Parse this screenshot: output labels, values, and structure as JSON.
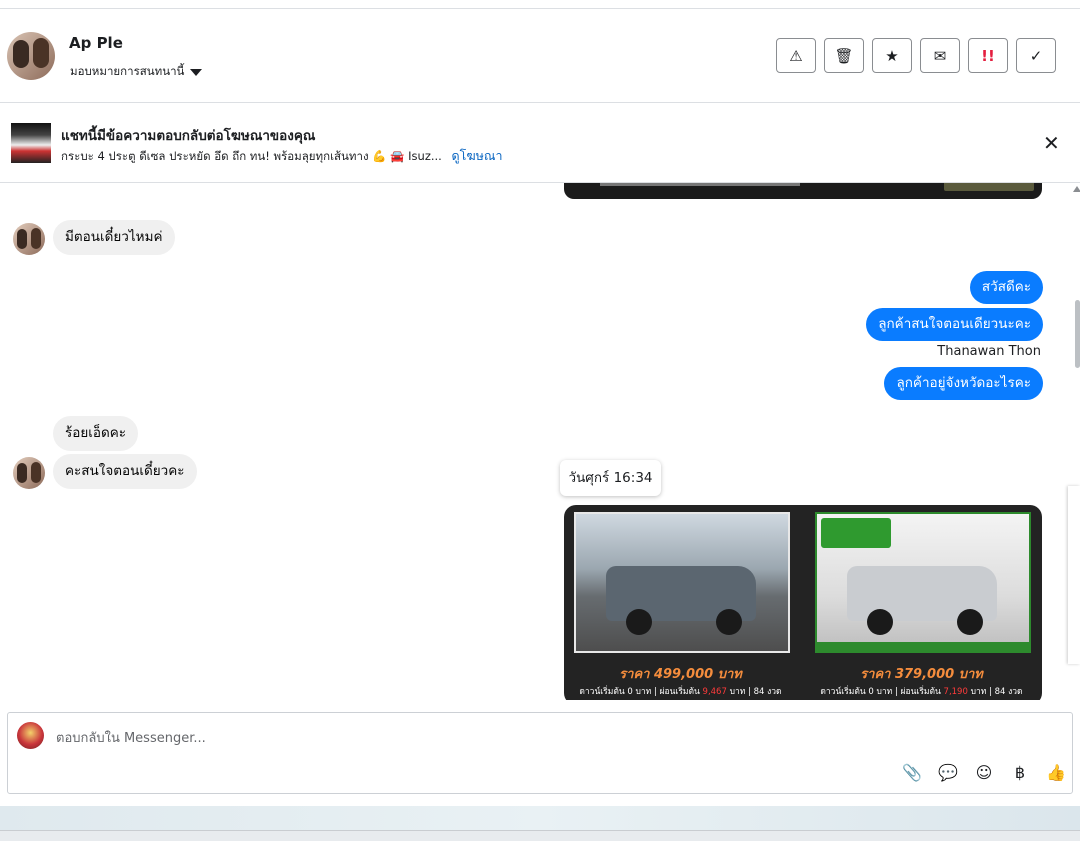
{
  "header": {
    "contact_name": "Ap Ple",
    "assign_label": "มอบหมายการสนทนานี้",
    "actions": [
      {
        "name": "report-spam-icon",
        "glyph": "⚠"
      },
      {
        "name": "trash-icon",
        "glyph": "🗑"
      },
      {
        "name": "star-icon",
        "glyph": "★"
      },
      {
        "name": "mark-unread-icon",
        "glyph": "✉"
      },
      {
        "name": "follow-up-icon",
        "glyph": "!!"
      },
      {
        "name": "done-check-icon",
        "glyph": "✓"
      }
    ]
  },
  "ad_banner": {
    "title": "แชทนี้มีข้อความตอบกลับต่อโฆษณาของคุณ",
    "description": "กระบะ 4 ประตู ดีเซล ประหยัด อึด ถึก ทน! พร้อมลุยทุกเส้นทาง 💪 🚘 Isuz...",
    "link_label": "ดูโฆษณา",
    "close_glyph": "✕"
  },
  "messages": {
    "in_1": "มีตอนเดี๋ยวไหมค่",
    "out_1": "สวัสดีคะ",
    "out_2": "ลูกค้าสนใจตอนเดียวนะคะ",
    "sender_name": "Thanawan Thon",
    "out_3": "ลูกค้าอยู่จังหวัดอะไรคะ",
    "in_2": "ร้อยเอ็ดคะ",
    "in_3": "คะสนใจตอนเดี๋ยวคะ",
    "time_tooltip": "วันศุกร์ 16:34"
  },
  "cars": [
    {
      "price": "ราคา 499,000 บาท",
      "down_prefix": "ดาวน์เริ่มต้น 0 บาท | ผ่อนเริ่มต้น",
      "monthly": "9,467",
      "down_suffix": "บาท | 84 งวด"
    },
    {
      "price": "ราคา 379,000 บาท",
      "down_prefix": "ดาวน์เริ่มต้น 0 บาท | ผ่อนเริ่มต้น",
      "monthly": "7,190",
      "down_suffix": "บาท | 84 งวด"
    }
  ],
  "composer": {
    "placeholder": "ตอบกลับใน Messenger...",
    "tools": [
      {
        "name": "attach-icon",
        "glyph": "📎"
      },
      {
        "name": "saved-replies-icon",
        "glyph": "💬"
      },
      {
        "name": "emoji-icon",
        "glyph": "☺"
      },
      {
        "name": "payment-icon",
        "glyph": "฿"
      },
      {
        "name": "thumbs-up-icon",
        "glyph": "👍"
      }
    ]
  },
  "colors": {
    "brand_blue": "#0a7cff",
    "link_blue": "#0a66c2",
    "incoming_bubble": "#f0f0f0",
    "price_orange": "#f58d3d",
    "follow_up_red": "#e41e3f"
  }
}
